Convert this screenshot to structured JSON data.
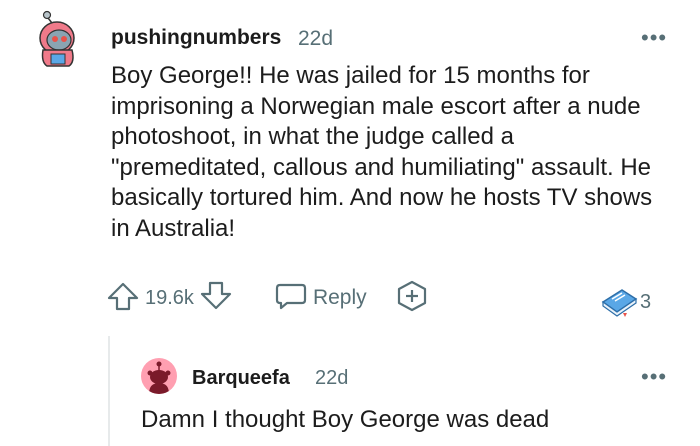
{
  "comment": {
    "username": "pushingnumbers",
    "age": "22d",
    "body": "Boy George!! He was jailed for 15 months for imprisoning a Norwegian male escort after a nude photoshoot, in what the judge called a \"premeditated, callous and humiliating\" assault. He basically tortured him. And now he hosts TV shows in Australia!",
    "vote_count": "19.6k",
    "reply_label": "Reply",
    "award_count": "3"
  },
  "reply_comment": {
    "username": "Barqueefa",
    "age": "22d",
    "body": "Damn I thought Boy George was dead"
  },
  "more_glyph": "•••",
  "colors": {
    "meta": "#576f76",
    "avatar2_bg": "#ff9fb1",
    "snoo_hood": "#e8534a",
    "award_blue": "#5aa7e6"
  }
}
